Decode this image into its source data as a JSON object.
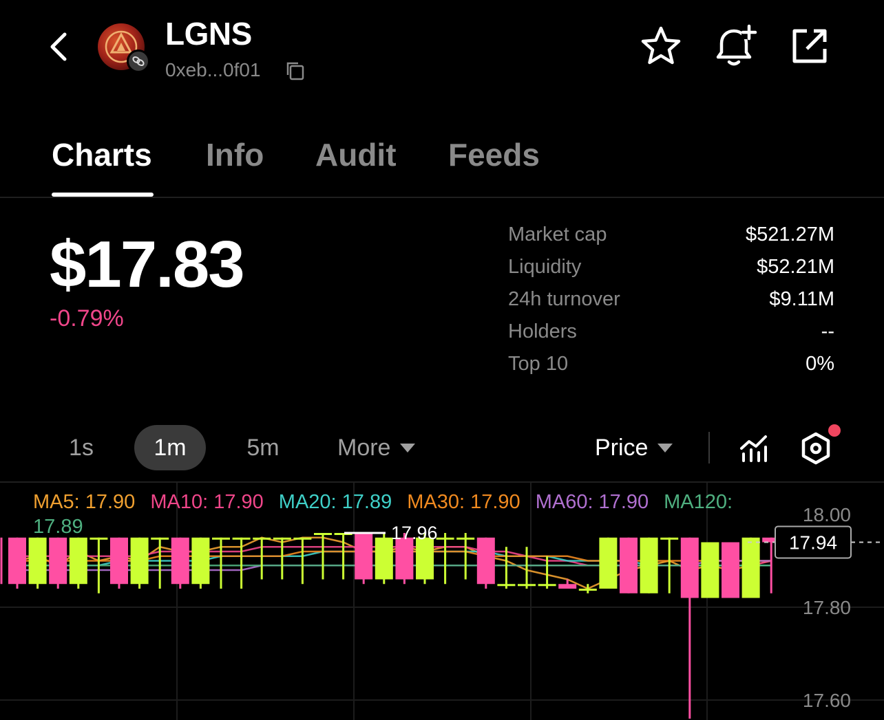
{
  "header": {
    "token_name": "LGNS",
    "token_address": "0xeb...0f01"
  },
  "tabs": [
    {
      "label": "Charts",
      "active": true
    },
    {
      "label": "Info",
      "active": false
    },
    {
      "label": "Audit",
      "active": false
    },
    {
      "label": "Feeds",
      "active": false
    }
  ],
  "price": {
    "value": "$17.83",
    "change": "-0.79%",
    "change_color": "#f0468a"
  },
  "stats": [
    {
      "label": "Market cap",
      "value": "$521.27M"
    },
    {
      "label": "Liquidity",
      "value": "$52.21M"
    },
    {
      "label": "24h turnover",
      "value": "$9.11M"
    },
    {
      "label": "Holders",
      "value": "--"
    },
    {
      "label": "Top 10",
      "value": "0%"
    }
  ],
  "toolbar": {
    "intervals": [
      "1s",
      "1m",
      "5m"
    ],
    "selected_interval": "1m",
    "more_label": "More",
    "price_label": "Price"
  },
  "ma_legend": [
    {
      "label": "MA5: 17.90",
      "color": "#f0a030"
    },
    {
      "label": "MA10: 17.90",
      "color": "#f0468a"
    },
    {
      "label": "MA20: 17.89",
      "color": "#3fd0c8"
    },
    {
      "label": "MA30: 17.90",
      "color": "#f08a20"
    },
    {
      "label": "MA60: 17.90",
      "color": "#b070d0"
    },
    {
      "label": "MA120: 17.89",
      "color": "#4fb080"
    }
  ],
  "colors": {
    "up": "#ccff33",
    "down": "#ff4fa3"
  },
  "chart_data": {
    "type": "candlestick",
    "y_axis_labels": [
      "18.00",
      "17.80",
      "17.60"
    ],
    "ylim": [
      17.56,
      18.06
    ],
    "current_price_label": "17.94",
    "current_price": 17.94,
    "max_marker_label": "17.96",
    "max_marker": 17.96,
    "candles": [
      {
        "o": 17.95,
        "c": 17.85,
        "h": 17.95,
        "l": 17.84
      },
      {
        "o": 17.85,
        "c": 17.95,
        "h": 17.95,
        "l": 17.84
      },
      {
        "o": 17.95,
        "c": 17.85,
        "h": 17.95,
        "l": 17.84
      },
      {
        "o": 17.85,
        "c": 17.95,
        "h": 17.95,
        "l": 17.84
      },
      {
        "o": 17.95,
        "c": 17.95,
        "h": 17.95,
        "l": 17.83
      },
      {
        "o": 17.95,
        "c": 17.85,
        "h": 17.95,
        "l": 17.84
      },
      {
        "o": 17.85,
        "c": 17.95,
        "h": 17.95,
        "l": 17.84
      },
      {
        "o": 17.95,
        "c": 17.95,
        "h": 17.95,
        "l": 17.84
      },
      {
        "o": 17.95,
        "c": 17.85,
        "h": 17.95,
        "l": 17.84
      },
      {
        "o": 17.85,
        "c": 17.95,
        "h": 17.95,
        "l": 17.84
      },
      {
        "o": 17.95,
        "c": 17.95,
        "h": 17.95,
        "l": 17.84
      },
      {
        "o": 17.95,
        "c": 17.95,
        "h": 17.95,
        "l": 17.84
      },
      {
        "o": 17.95,
        "c": 17.95,
        "h": 17.95,
        "l": 17.86
      },
      {
        "o": 17.95,
        "c": 17.95,
        "h": 17.95,
        "l": 17.86
      },
      {
        "o": 17.95,
        "c": 17.95,
        "h": 17.95,
        "l": 17.85
      },
      {
        "o": 17.96,
        "c": 17.96,
        "h": 17.96,
        "l": 17.86
      },
      {
        "o": 17.96,
        "c": 17.96,
        "h": 17.96,
        "l": 17.86
      },
      {
        "o": 17.96,
        "c": 17.86,
        "h": 17.96,
        "l": 17.85
      },
      {
        "o": 17.86,
        "c": 17.95,
        "h": 17.96,
        "l": 17.85
      },
      {
        "o": 17.95,
        "c": 17.86,
        "h": 17.96,
        "l": 17.85
      },
      {
        "o": 17.86,
        "c": 17.95,
        "h": 17.96,
        "l": 17.85
      },
      {
        "o": 17.95,
        "c": 17.95,
        "h": 17.96,
        "l": 17.85
      },
      {
        "o": 17.95,
        "c": 17.95,
        "h": 17.96,
        "l": 17.86
      },
      {
        "o": 17.95,
        "c": 17.85,
        "h": 17.95,
        "l": 17.84
      },
      {
        "o": 17.85,
        "c": 17.85,
        "h": 17.93,
        "l": 17.84
      },
      {
        "o": 17.85,
        "c": 17.85,
        "h": 17.93,
        "l": 17.84
      },
      {
        "o": 17.85,
        "c": 17.85,
        "h": 17.91,
        "l": 17.84
      },
      {
        "o": 17.85,
        "c": 17.84,
        "h": 17.86,
        "l": 17.84
      },
      {
        "o": 17.84,
        "c": 17.84,
        "h": 17.85,
        "l": 17.83
      },
      {
        "o": 17.84,
        "c": 17.95,
        "h": 17.95,
        "l": 17.84
      },
      {
        "o": 17.95,
        "c": 17.83,
        "h": 17.95,
        "l": 17.83
      },
      {
        "o": 17.83,
        "c": 17.95,
        "h": 17.95,
        "l": 17.83
      },
      {
        "o": 17.95,
        "c": 17.95,
        "h": 17.95,
        "l": 17.83
      },
      {
        "o": 17.95,
        "c": 17.82,
        "h": 17.95,
        "l": 17.56
      },
      {
        "o": 17.82,
        "c": 17.94,
        "h": 17.94,
        "l": 17.82
      },
      {
        "o": 17.94,
        "c": 17.82,
        "h": 17.94,
        "l": 17.82
      },
      {
        "o": 17.82,
        "c": 17.95,
        "h": 17.95,
        "l": 17.82
      },
      {
        "o": 17.95,
        "c": 17.94,
        "h": 17.95,
        "l": 17.83
      }
    ],
    "ma_lines": [
      {
        "name": "MA5",
        "color": "#f0a030",
        "values": [
          17.9,
          17.91,
          17.89,
          17.92,
          17.9,
          17.91,
          17.9,
          17.93,
          17.92,
          17.92,
          17.93,
          17.93,
          17.95,
          17.94,
          17.95,
          17.95,
          17.94,
          17.92,
          17.92,
          17.93,
          17.92,
          17.93,
          17.93,
          17.91,
          17.9,
          17.88,
          17.87,
          17.86,
          17.84,
          17.86,
          17.88,
          17.89,
          17.9,
          17.88,
          17.89,
          17.88,
          17.89,
          17.9
        ]
      },
      {
        "name": "MA10",
        "color": "#f0468a",
        "values": [
          17.91,
          17.91,
          17.91,
          17.91,
          17.91,
          17.91,
          17.91,
          17.92,
          17.92,
          17.92,
          17.92,
          17.92,
          17.93,
          17.93,
          17.93,
          17.93,
          17.93,
          17.93,
          17.93,
          17.93,
          17.93,
          17.93,
          17.93,
          17.92,
          17.92,
          17.91,
          17.9,
          17.9,
          17.89,
          17.89,
          17.89,
          17.89,
          17.89,
          17.89,
          17.89,
          17.89,
          17.89,
          17.9
        ]
      },
      {
        "name": "MA20",
        "color": "#3fd0c8",
        "values": [
          17.89,
          17.89,
          17.89,
          17.89,
          17.89,
          17.9,
          17.9,
          17.9,
          17.9,
          17.9,
          17.91,
          17.91,
          17.91,
          17.91,
          17.91,
          17.92,
          17.92,
          17.92,
          17.92,
          17.92,
          17.92,
          17.92,
          17.92,
          17.92,
          17.91,
          17.91,
          17.91,
          17.9,
          17.9,
          17.9,
          17.9,
          17.89,
          17.89,
          17.89,
          17.89,
          17.89,
          17.89,
          17.89
        ]
      },
      {
        "name": "MA30",
        "color": "#f08a20",
        "values": [
          17.9,
          17.9,
          17.9,
          17.9,
          17.9,
          17.9,
          17.9,
          17.91,
          17.91,
          17.91,
          17.91,
          17.91,
          17.91,
          17.91,
          17.92,
          17.92,
          17.92,
          17.92,
          17.92,
          17.92,
          17.92,
          17.92,
          17.92,
          17.91,
          17.91,
          17.91,
          17.91,
          17.91,
          17.9,
          17.9,
          17.9,
          17.9,
          17.9,
          17.9,
          17.9,
          17.9,
          17.9,
          17.9
        ]
      },
      {
        "name": "MA60",
        "color": "#b070d0",
        "values": [
          17.88,
          17.88,
          17.88,
          17.88,
          17.88,
          17.88,
          17.88,
          17.88,
          17.88,
          17.88,
          17.88,
          17.88,
          17.89,
          17.89,
          17.89,
          17.89,
          17.89,
          17.89,
          17.89,
          17.89,
          17.89,
          17.89,
          17.89,
          17.89,
          17.89,
          17.89,
          17.89,
          17.89,
          17.89,
          17.89,
          17.89,
          17.89,
          17.89,
          17.89,
          17.9,
          17.9,
          17.9,
          17.9
        ]
      },
      {
        "name": "MA120",
        "color": "#4fb080",
        "values": [
          17.89,
          17.89,
          17.89,
          17.89,
          17.89,
          17.89,
          17.89,
          17.89,
          17.89,
          17.89,
          17.89,
          17.89,
          17.89,
          17.89,
          17.89,
          17.89,
          17.89,
          17.89,
          17.89,
          17.89,
          17.89,
          17.89,
          17.89,
          17.89,
          17.89,
          17.89,
          17.89,
          17.89,
          17.89,
          17.89,
          17.89,
          17.89,
          17.89,
          17.89,
          17.89,
          17.89,
          17.89,
          17.89
        ]
      }
    ]
  }
}
